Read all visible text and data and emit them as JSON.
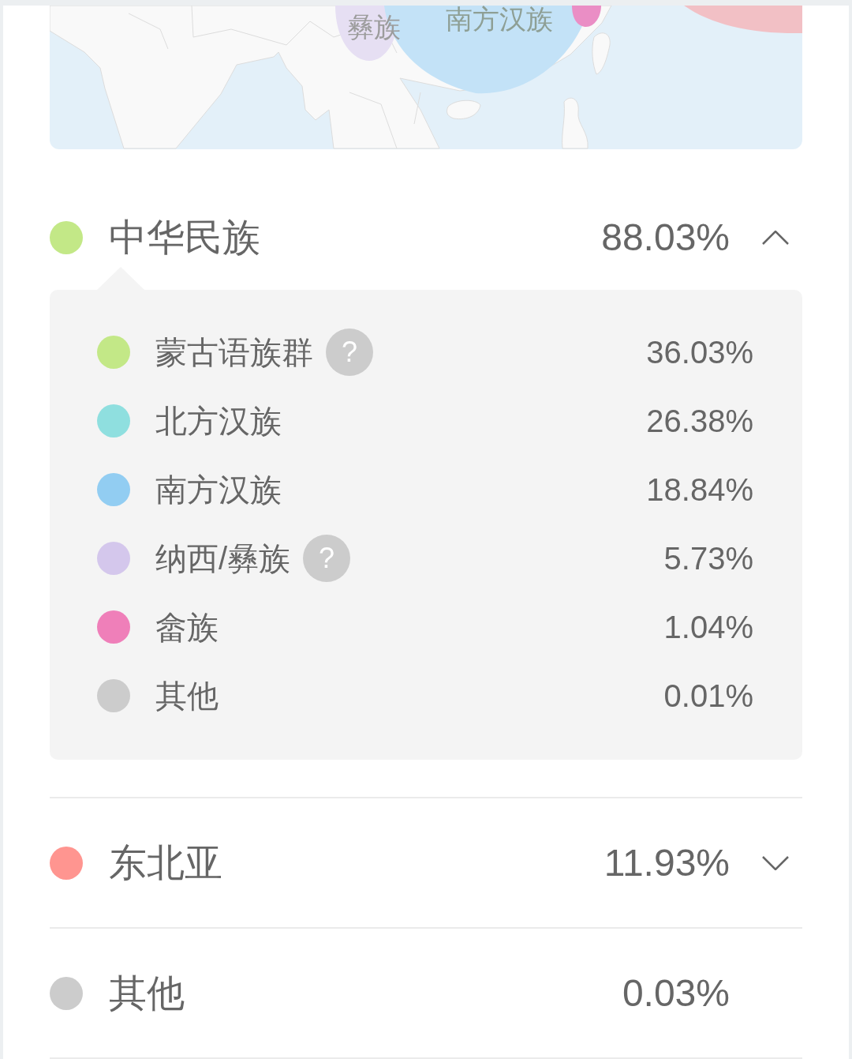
{
  "map": {
    "bubbles": [
      {
        "label": "彝族",
        "color": "#e6dff3"
      },
      {
        "label": "南方汉族",
        "color": "#c3e2f7"
      },
      {
        "color": "#ea8ec5"
      },
      {
        "color": "#f2c0c5"
      }
    ]
  },
  "groups": [
    {
      "name": "中华民族",
      "percent": "88.03%",
      "color": "#c3e887",
      "expandable": true,
      "expanded": true,
      "children": [
        {
          "name": "蒙古语族群",
          "percent": "36.03%",
          "color": "#c3e887",
          "help": "?"
        },
        {
          "name": "北方汉族",
          "percent": "26.38%",
          "color": "#8fdfdf"
        },
        {
          "name": "南方汉族",
          "percent": "18.84%",
          "color": "#92cdf2"
        },
        {
          "name": "纳西/彝族",
          "percent": "5.73%",
          "color": "#d4c7ec",
          "help": "?"
        },
        {
          "name": "畲族",
          "percent": "1.04%",
          "color": "#ef7fb9"
        },
        {
          "name": "其他",
          "percent": "0.01%",
          "color": "#cccccc"
        }
      ]
    },
    {
      "name": "东北亚",
      "percent": "11.93%",
      "color": "#ff9590",
      "expandable": true,
      "expanded": false
    },
    {
      "name": "其他",
      "percent": "0.03%",
      "color": "#cccccc",
      "expandable": false
    }
  ]
}
